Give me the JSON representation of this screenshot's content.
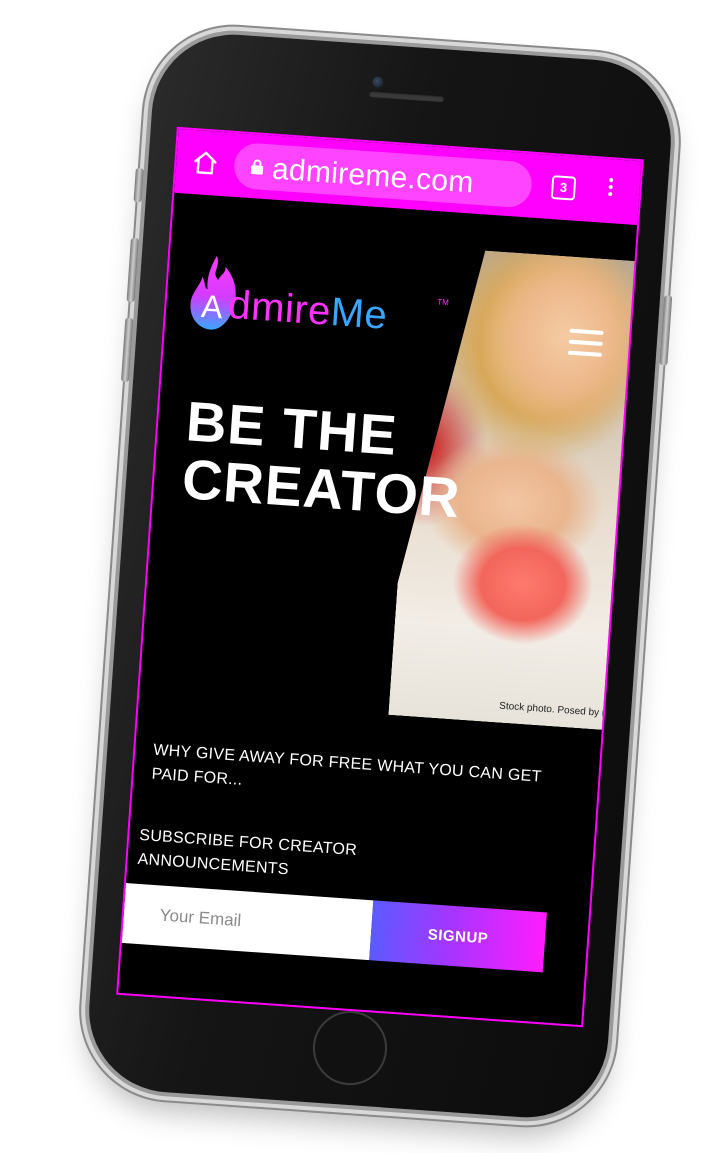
{
  "browser": {
    "url": "admireme.com",
    "tab_count": "3"
  },
  "header": {
    "logo_text_prefix": "dmire",
    "logo_text_suffix": "Me",
    "logo_letter": "A",
    "logo_tm": "TM"
  },
  "hero": {
    "headline": "BE THE\nCREATOR",
    "photo_caption": "Stock photo. Posed by model"
  },
  "content": {
    "tagline": "WHY GIVE AWAY FOR FREE WHAT YOU CAN GET PAID FOR...",
    "subscribe_label": "SUBSCRIBE FOR CREATOR ANNOUNCEMENTS"
  },
  "form": {
    "email_placeholder": "Your Email",
    "signup_label": "SIGNUP"
  },
  "colors": {
    "brand_magenta": "#ff00ff",
    "logo_blue": "#3aa6ff",
    "button_gradient_start": "#5b5bff",
    "button_gradient_end": "#ff1cff"
  }
}
